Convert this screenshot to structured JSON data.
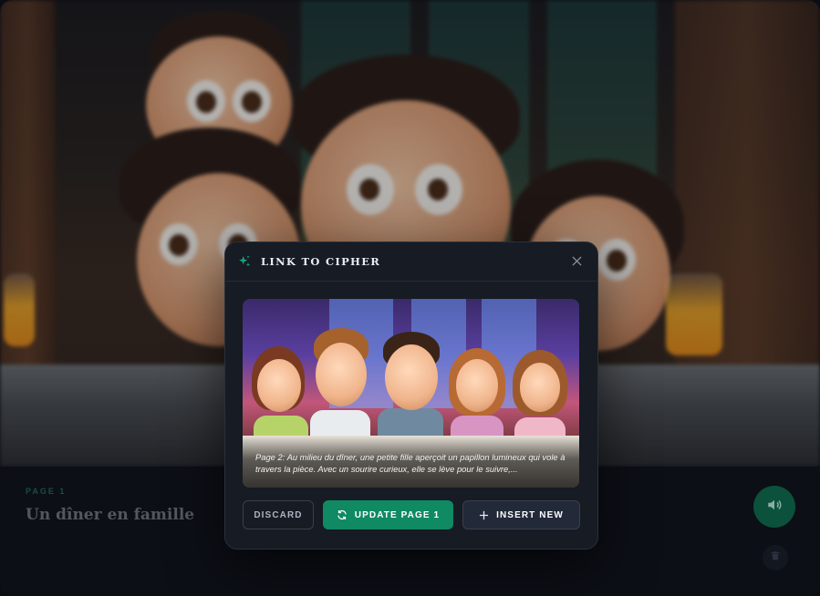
{
  "background": {
    "page_kicker": "PAGE 1",
    "page_title": "Un dîner en famille"
  },
  "modal": {
    "title": "LINK TO CIPHER",
    "caption": "Page 2: Au milieu du dîner, une petite fille aperçoit un papillon lumineux qui vole à travers la pièce. Avec un sourire curieux, elle se lève pour le suivre,...",
    "buttons": {
      "discard": "DISCARD",
      "update": "UPDATE PAGE 1",
      "insert": "INSERT NEW"
    }
  },
  "icons": {
    "title_icon": "sparkle-icon",
    "close": "close-icon",
    "update": "refresh-icon",
    "insert": "plus-icon",
    "audio": "speaker-icon",
    "delete": "trash-icon"
  },
  "colors": {
    "accent": "#0f8a63",
    "modal_bg": "#161b24",
    "audio_button": "#0f6e4f"
  }
}
